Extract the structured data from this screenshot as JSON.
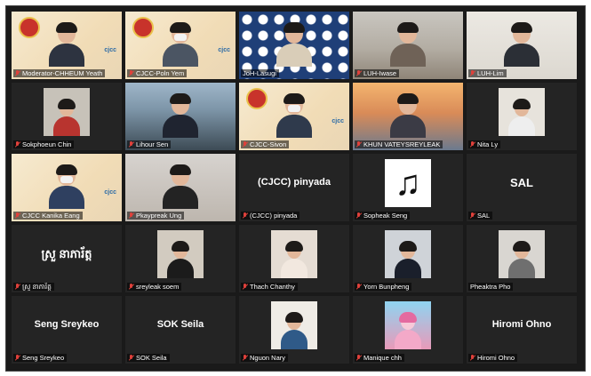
{
  "participants": [
    {
      "name": "Moderator-CHHEUM Yeath",
      "center": ""
    },
    {
      "name": "CJCC-Poln Yem",
      "center": ""
    },
    {
      "name": "JoH-Lasugi",
      "center": ""
    },
    {
      "name": "LUH-Iwase",
      "center": ""
    },
    {
      "name": "LUH-Lim",
      "center": ""
    },
    {
      "name": "Sokphoeun Chin",
      "center": ""
    },
    {
      "name": "Lihour Sen",
      "center": ""
    },
    {
      "name": "CJCC-Sivon",
      "center": ""
    },
    {
      "name": "KHUN VATEYSREYLEAK",
      "center": ""
    },
    {
      "name": "Nita Ly",
      "center": ""
    },
    {
      "name": "CJCC Kanika Eang",
      "center": ""
    },
    {
      "name": "Pkaypreak Ung",
      "center": ""
    },
    {
      "name": "(CJCC) pinyada",
      "center": "(CJCC) pinyada"
    },
    {
      "name": "Sopheak Seng",
      "center": ""
    },
    {
      "name": "SAL",
      "center": "SAL"
    },
    {
      "name": "ស្រួ នាភារ័ត្ត",
      "center": "ស្រួ នាភារ័ត្ត"
    },
    {
      "name": "sreyleak soem",
      "center": ""
    },
    {
      "name": "Thach Chanthy",
      "center": ""
    },
    {
      "name": "Yorn Bunpheng",
      "center": ""
    },
    {
      "name": "Pheaktra Pho",
      "center": ""
    },
    {
      "name": "Seng Sreykeo",
      "center": "Seng Sreykeo"
    },
    {
      "name": "SOK Seila",
      "center": "SOK Seila"
    },
    {
      "name": "Nguon Nary",
      "center": ""
    },
    {
      "name": "Manique chh",
      "center": ""
    },
    {
      "name": "Hiromi Ohno",
      "center": "Hiromi Ohno"
    }
  ],
  "branding": {
    "cjcc_mark": "cjcc"
  },
  "icons": {
    "mic": "mic-muted-icon",
    "note": "music-note-icon"
  },
  "colors": {
    "active_border": "#d9d23b",
    "muted_mic": "#e0413b",
    "tile_bg": "#242424"
  }
}
